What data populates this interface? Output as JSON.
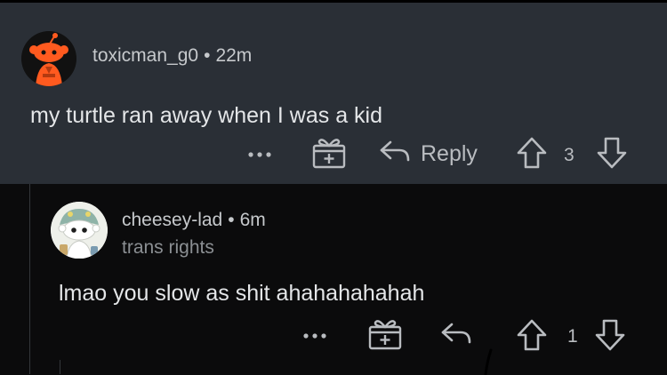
{
  "comment": {
    "username": "toxicman_g0",
    "separator": "•",
    "time": "22m",
    "text": "my turtle ran away when I was a kid",
    "more_label": "•••",
    "reply_label": "Reply",
    "score": "3"
  },
  "reply": {
    "username": "cheesey-lad",
    "separator": "•",
    "time": "6m",
    "flair": "trans rights",
    "text": "lmao you slow as shit ahahahahahah",
    "more_label": "•••",
    "score": "1"
  },
  "colors": {
    "parent_bg": "#2a2f36",
    "reply_bg": "#0b0b0c",
    "avatar_orange": "#ff5a1f",
    "text": "#e4e6e8",
    "meta": "#8b8f93"
  },
  "icons": [
    "snoo-avatar-orange",
    "snoo-avatar-green-hat",
    "more-dots-icon",
    "gift-award-icon",
    "reply-arrow-icon",
    "upvote-icon",
    "downvote-icon"
  ]
}
